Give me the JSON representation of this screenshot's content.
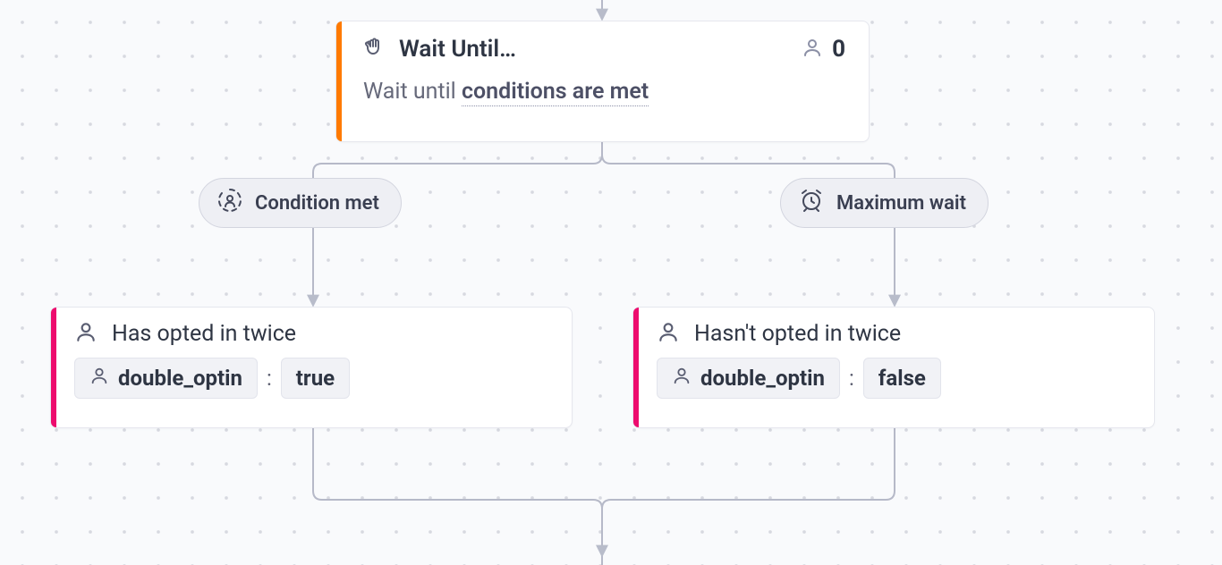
{
  "wait_card": {
    "title": "Wait Until…",
    "count": "0",
    "desc_prefix": "Wait until ",
    "desc_link": "conditions are met"
  },
  "branches": {
    "condition_met": {
      "chip_label": "Condition met",
      "card_title": "Has opted in twice",
      "attr": "double_optin",
      "value": "true"
    },
    "max_wait": {
      "chip_label": "Maximum wait",
      "card_title": "Hasn't opted in twice",
      "attr": "double_optin",
      "value": "false"
    }
  }
}
